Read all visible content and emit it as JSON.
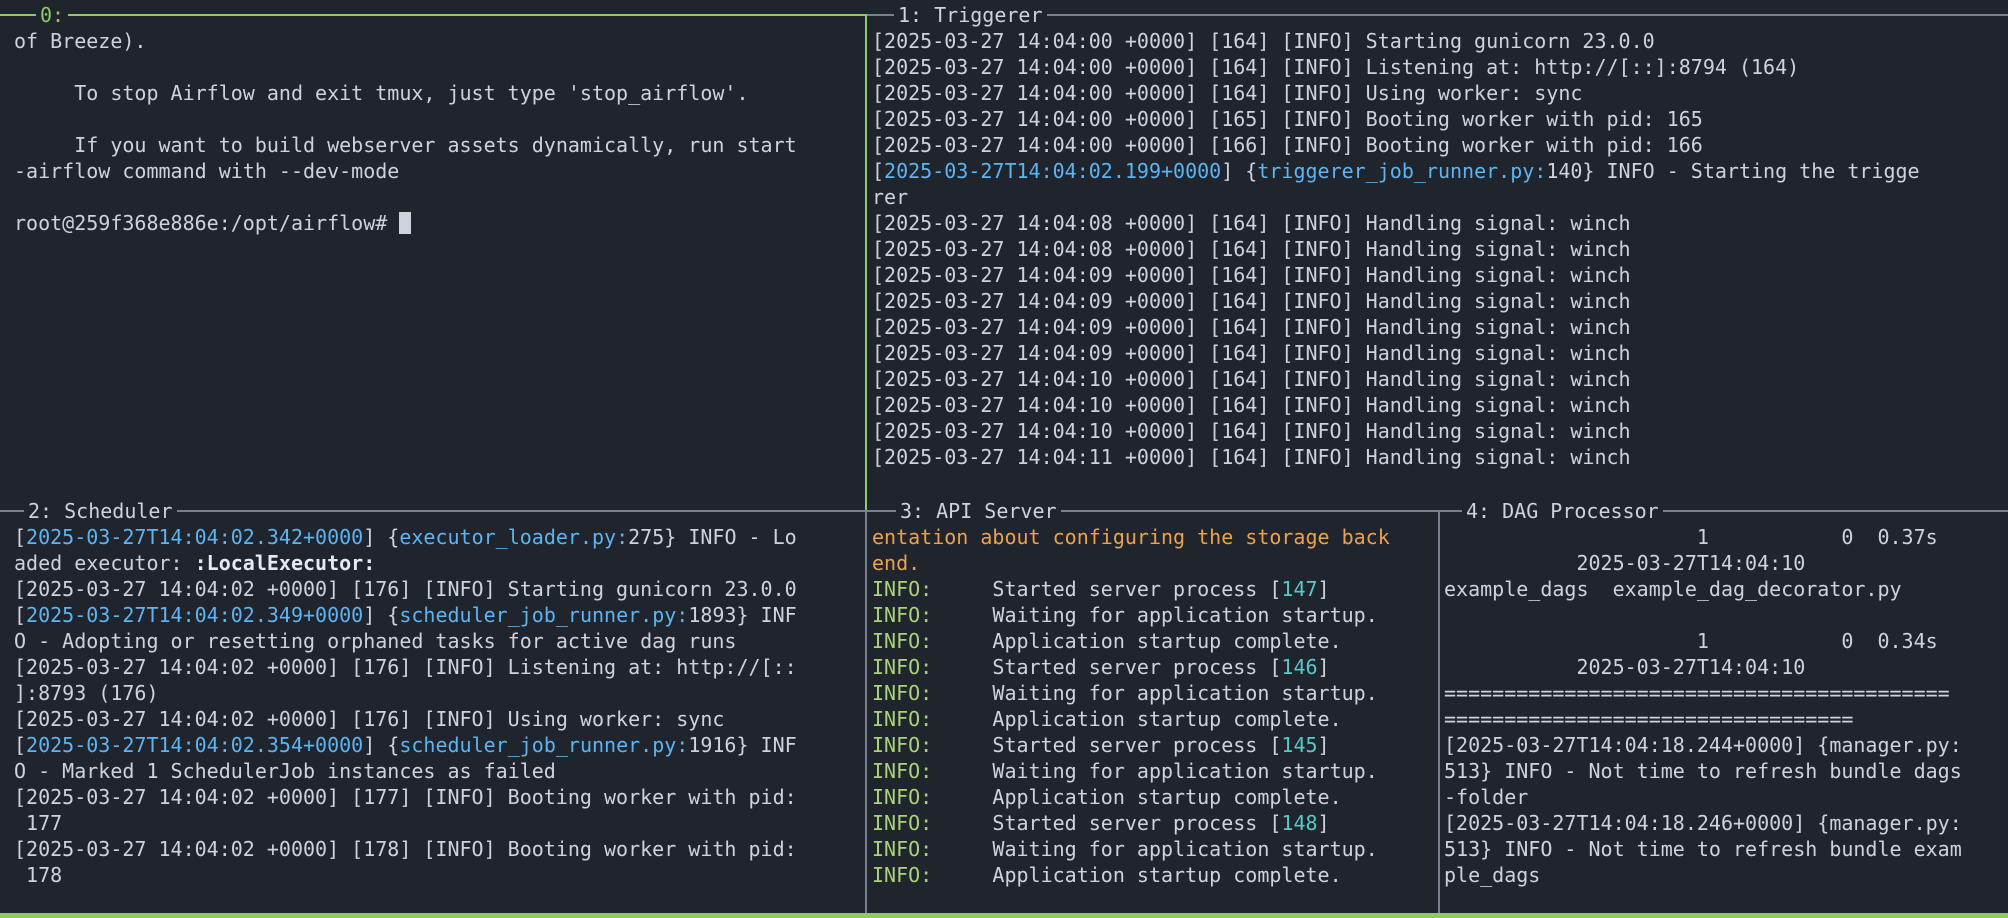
{
  "panes": {
    "p0": {
      "title": "0:",
      "lines": [
        [
          {
            "t": "of Breeze)."
          }
        ],
        [
          {
            "t": ""
          }
        ],
        [
          {
            "t": "     To stop Airflow and exit tmux, just type 'stop_airflow'."
          }
        ],
        [
          {
            "t": ""
          }
        ],
        [
          {
            "t": "     If you want to build webserver assets dynamically, run start"
          }
        ],
        [
          {
            "t": "-airflow command with --dev-mode"
          }
        ],
        [
          {
            "t": ""
          }
        ],
        [
          {
            "t": "root@259f368e886e:/opt/airflow# "
          }
        ]
      ]
    },
    "p1": {
      "title": "1: Triggerer",
      "lines": [
        [
          {
            "t": "[2025-03-27 14:04:00 +0000] [164] [INFO] Starting gunicorn 23.0.0"
          }
        ],
        [
          {
            "t": "[2025-03-27 14:04:00 +0000] [164] [INFO] Listening at: http://[::]:8794 (164)"
          }
        ],
        [
          {
            "t": "[2025-03-27 14:04:00 +0000] [164] [INFO] Using worker: sync"
          }
        ],
        [
          {
            "t": "[2025-03-27 14:04:00 +0000] [165] [INFO] Booting worker with pid: 165"
          }
        ],
        [
          {
            "t": "[2025-03-27 14:04:00 +0000] [166] [INFO] Booting worker with pid: 166"
          }
        ],
        [
          {
            "t": "["
          },
          {
            "t": "2025-03-27T14:04:02.199+0000",
            "c": "hl"
          },
          {
            "t": "] {"
          },
          {
            "t": "triggerer_job_runner.py:",
            "c": "hl"
          },
          {
            "t": "140} INFO - Starting the trigge"
          }
        ],
        [
          {
            "t": "rer"
          }
        ],
        [
          {
            "t": "[2025-03-27 14:04:08 +0000] [164] [INFO] Handling signal: winch"
          }
        ],
        [
          {
            "t": "[2025-03-27 14:04:08 +0000] [164] [INFO] Handling signal: winch"
          }
        ],
        [
          {
            "t": "[2025-03-27 14:04:09 +0000] [164] [INFO] Handling signal: winch"
          }
        ],
        [
          {
            "t": "[2025-03-27 14:04:09 +0000] [164] [INFO] Handling signal: winch"
          }
        ],
        [
          {
            "t": "[2025-03-27 14:04:09 +0000] [164] [INFO] Handling signal: winch"
          }
        ],
        [
          {
            "t": "[2025-03-27 14:04:09 +0000] [164] [INFO] Handling signal: winch"
          }
        ],
        [
          {
            "t": "[2025-03-27 14:04:10 +0000] [164] [INFO] Handling signal: winch"
          }
        ],
        [
          {
            "t": "[2025-03-27 14:04:10 +0000] [164] [INFO] Handling signal: winch"
          }
        ],
        [
          {
            "t": "[2025-03-27 14:04:10 +0000] [164] [INFO] Handling signal: winch"
          }
        ],
        [
          {
            "t": "[2025-03-27 14:04:11 +0000] [164] [INFO] Handling signal: winch"
          }
        ]
      ]
    },
    "p2": {
      "title": "2: Scheduler",
      "lines": [
        [
          {
            "t": "["
          },
          {
            "t": "2025-03-27T14:04:02.342+0000",
            "c": "hl"
          },
          {
            "t": "] {"
          },
          {
            "t": "executor_loader.py:",
            "c": "hl"
          },
          {
            "t": "275} INFO - Lo"
          }
        ],
        [
          {
            "t": "aded executor: "
          },
          {
            "t": ":LocalExecutor:",
            "c": "bold"
          }
        ],
        [
          {
            "t": "[2025-03-27 14:04:02 +0000] [176] [INFO] Starting gunicorn 23.0.0"
          }
        ],
        [
          {
            "t": "["
          },
          {
            "t": "2025-03-27T14:04:02.349+0000",
            "c": "hl"
          },
          {
            "t": "] {"
          },
          {
            "t": "scheduler_job_runner.py:",
            "c": "hl"
          },
          {
            "t": "1893} INF"
          }
        ],
        [
          {
            "t": "O - Adopting or resetting orphaned tasks for active dag runs"
          }
        ],
        [
          {
            "t": "[2025-03-27 14:04:02 +0000] [176] [INFO] Listening at: http://[::"
          }
        ],
        [
          {
            "t": "]:8793 (176)"
          }
        ],
        [
          {
            "t": "[2025-03-27 14:04:02 +0000] [176] [INFO] Using worker: sync"
          }
        ],
        [
          {
            "t": "["
          },
          {
            "t": "2025-03-27T14:04:02.354+0000",
            "c": "hl"
          },
          {
            "t": "] {"
          },
          {
            "t": "scheduler_job_runner.py:",
            "c": "hl"
          },
          {
            "t": "1916} INF"
          }
        ],
        [
          {
            "t": "O - Marked 1 SchedulerJob instances as failed"
          }
        ],
        [
          {
            "t": "[2025-03-27 14:04:02 +0000] [177] [INFO] Booting worker with pid:"
          }
        ],
        [
          {
            "t": " 177"
          }
        ],
        [
          {
            "t": "[2025-03-27 14:04:02 +0000] [178] [INFO] Booting worker with pid:"
          }
        ],
        [
          {
            "t": " 178"
          }
        ]
      ]
    },
    "p3": {
      "title": "3: API Server",
      "lines": [
        [
          {
            "t": "entation about configuring the storage back",
            "c": "warn"
          }
        ],
        [
          {
            "t": "end.",
            "c": "warn"
          }
        ],
        [
          {
            "t": "INFO:",
            "c": "ok"
          },
          {
            "t": "     Started server process ["
          },
          {
            "t": "147",
            "c": "pid"
          },
          {
            "t": "]"
          }
        ],
        [
          {
            "t": "INFO:",
            "c": "ok"
          },
          {
            "t": "     Waiting for application startup."
          }
        ],
        [
          {
            "t": "INFO:",
            "c": "ok"
          },
          {
            "t": "     Application startup complete."
          }
        ],
        [
          {
            "t": "INFO:",
            "c": "ok"
          },
          {
            "t": "     Started server process ["
          },
          {
            "t": "146",
            "c": "pid"
          },
          {
            "t": "]"
          }
        ],
        [
          {
            "t": "INFO:",
            "c": "ok"
          },
          {
            "t": "     Waiting for application startup."
          }
        ],
        [
          {
            "t": "INFO:",
            "c": "ok"
          },
          {
            "t": "     Application startup complete."
          }
        ],
        [
          {
            "t": "INFO:",
            "c": "ok"
          },
          {
            "t": "     Started server process ["
          },
          {
            "t": "145",
            "c": "pid"
          },
          {
            "t": "]"
          }
        ],
        [
          {
            "t": "INFO:",
            "c": "ok"
          },
          {
            "t": "     Waiting for application startup."
          }
        ],
        [
          {
            "t": "INFO:",
            "c": "ok"
          },
          {
            "t": "     Application startup complete."
          }
        ],
        [
          {
            "t": "INFO:",
            "c": "ok"
          },
          {
            "t": "     Started server process ["
          },
          {
            "t": "148",
            "c": "pid"
          },
          {
            "t": "]"
          }
        ],
        [
          {
            "t": "INFO:",
            "c": "ok"
          },
          {
            "t": "     Waiting for application startup."
          }
        ],
        [
          {
            "t": "INFO:",
            "c": "ok"
          },
          {
            "t": "     Application startup complete."
          }
        ]
      ]
    },
    "p4": {
      "title": "4: DAG Processor",
      "lines": [
        [
          {
            "t": "                     1           0  0.37s"
          }
        ],
        [
          {
            "t": "           2025-03-27T14:04:10"
          }
        ],
        [
          {
            "t": "example_dags  example_dag_decorator.py"
          }
        ],
        [
          {
            "t": ""
          }
        ],
        [
          {
            "t": "                     1           0  0.34s"
          }
        ],
        [
          {
            "t": "           2025-03-27T14:04:10"
          }
        ],
        [
          {
            "t": "=========================================="
          }
        ],
        [
          {
            "t": "=================================="
          }
        ],
        [
          {
            "t": "[2025-03-27T14:04:18.244+0000] {manager.py:"
          }
        ],
        [
          {
            "t": "513} INFO - Not time to refresh bundle dags"
          }
        ],
        [
          {
            "t": "-folder"
          }
        ],
        [
          {
            "t": "[2025-03-27T14:04:18.246+0000] {manager.py:"
          }
        ],
        [
          {
            "t": "513} INFO - Not time to refresh bundle exam"
          }
        ],
        [
          {
            "t": "ple_dags"
          }
        ]
      ]
    }
  }
}
